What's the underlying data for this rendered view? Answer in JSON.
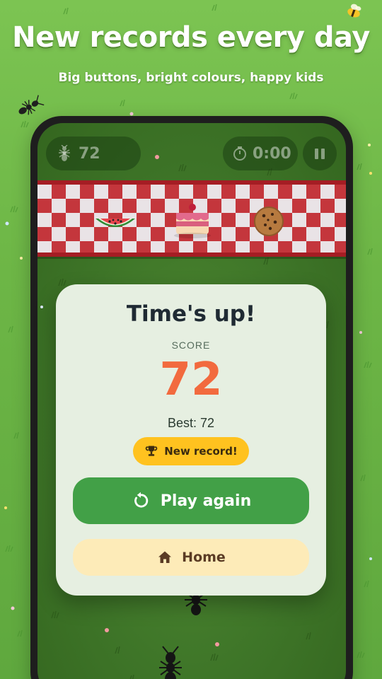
{
  "promo": {
    "headline": "New records every day",
    "subline": "Big buttons, bright colours, happy kids"
  },
  "hud": {
    "score": "72",
    "timer": "0:00",
    "score_icon": "ant-icon",
    "timer_icon": "stopwatch-icon",
    "pause_icon": "pause-icon"
  },
  "table": {
    "foods": [
      "watermelon",
      "cake",
      "cookie"
    ]
  },
  "modal": {
    "title": "Time's up!",
    "score_label": "SCORE",
    "score_value": "72",
    "best_text": "Best: 72",
    "badge_text": "New record!",
    "badge_icon": "trophy-icon",
    "play_again_label": "Play again",
    "play_again_icon": "restart-icon",
    "home_label": "Home",
    "home_icon": "home-icon"
  },
  "colors": {
    "background_green": "#6db646",
    "play_button": "#42a047",
    "home_button": "#fdebb8",
    "badge": "#ffc21f",
    "score": "#f26a3e",
    "modal_bg": "#e6efe1"
  }
}
